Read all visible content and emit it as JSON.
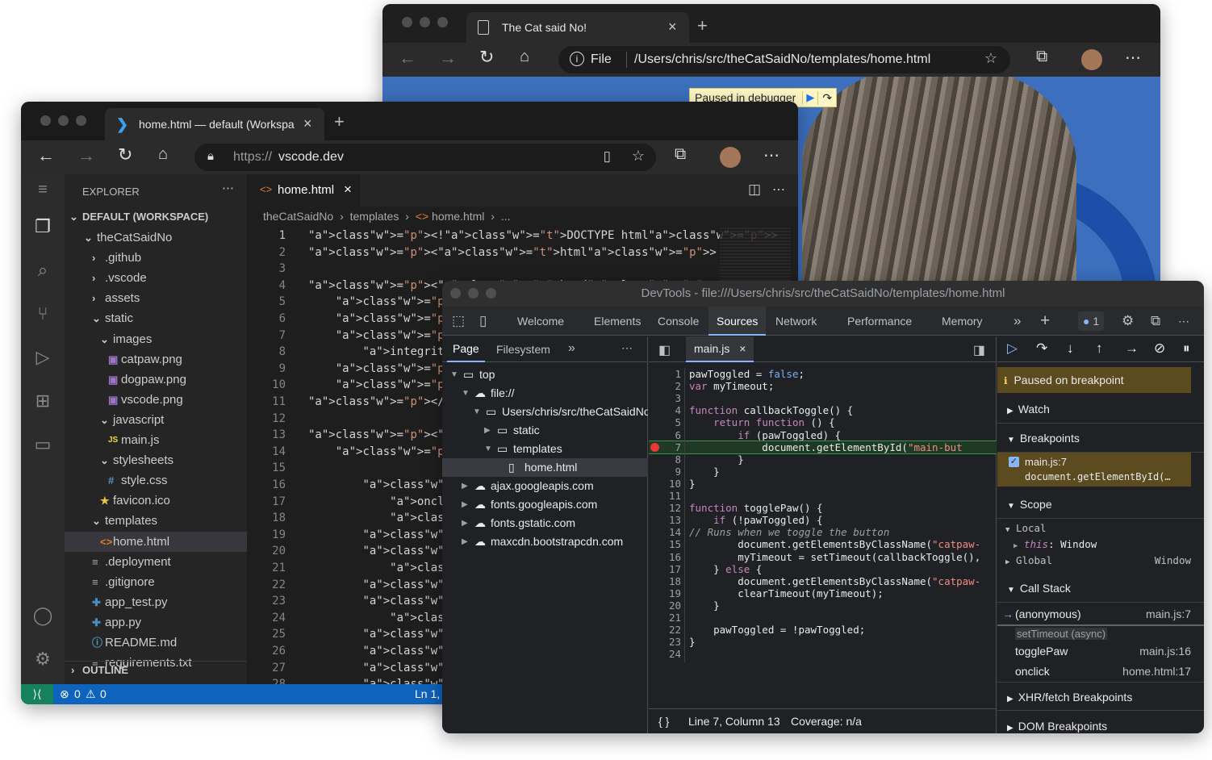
{
  "back_browser": {
    "tab_title": "The Cat said No!",
    "address_scheme": "File",
    "address_path": "/Users/chris/src/theCatSaidNo/templates/home.html",
    "paused_banner": "Paused in debugger"
  },
  "code_browser": {
    "tab_title": "home.html — default (Workspa",
    "address_prefix": "https://",
    "address_host": "vscode.dev"
  },
  "vscode": {
    "explorer_title": "EXPLORER",
    "workspace": "DEFAULT (WORKSPACE)",
    "tree": [
      {
        "label": "theCatSaidNo",
        "depth": 0,
        "kind": "folder-open"
      },
      {
        "label": ".github",
        "depth": 1,
        "kind": "folder"
      },
      {
        "label": ".vscode",
        "depth": 1,
        "kind": "folder"
      },
      {
        "label": "assets",
        "depth": 1,
        "kind": "folder"
      },
      {
        "label": "static",
        "depth": 1,
        "kind": "folder-open"
      },
      {
        "label": "images",
        "depth": 2,
        "kind": "folder-open"
      },
      {
        "label": "catpaw.png",
        "depth": 3,
        "kind": "image"
      },
      {
        "label": "dogpaw.png",
        "depth": 3,
        "kind": "image"
      },
      {
        "label": "vscode.png",
        "depth": 3,
        "kind": "image"
      },
      {
        "label": "javascript",
        "depth": 2,
        "kind": "folder-open"
      },
      {
        "label": "main.js",
        "depth": 3,
        "kind": "js"
      },
      {
        "label": "stylesheets",
        "depth": 2,
        "kind": "folder-open"
      },
      {
        "label": "style.css",
        "depth": 3,
        "kind": "css"
      },
      {
        "label": "favicon.ico",
        "depth": 2,
        "kind": "star"
      },
      {
        "label": "templates",
        "depth": 1,
        "kind": "folder-open"
      },
      {
        "label": "home.html",
        "depth": 2,
        "kind": "html"
      },
      {
        "label": ".deployment",
        "depth": 1,
        "kind": "text"
      },
      {
        "label": ".gitignore",
        "depth": 1,
        "kind": "text"
      },
      {
        "label": "app_test.py",
        "depth": 1,
        "kind": "py"
      },
      {
        "label": "app.py",
        "depth": 1,
        "kind": "py"
      },
      {
        "label": "README.md",
        "depth": 1,
        "kind": "info"
      },
      {
        "label": "requirements.txt",
        "depth": 1,
        "kind": "text"
      }
    ],
    "outline_label": "OUTLINE",
    "editor_tab": "home.html",
    "breadcrumb": [
      "theCatSaidNo",
      "templates",
      "home.html",
      "..."
    ],
    "code_lines": [
      "<!DOCTYPE html>",
      "<html>",
      "",
      "<head>",
      "    <title>The Cat s",
      "    <link href=\"http",
      "    <link rel=\"style",
      "        integrity=\"s",
      "    <link rel=\"style",
      "    <link rel='style",
      "</head>",
      "",
      "<body class=\"preload",
      "    <div class=\"cent",
      "",
      "        <button type",
      "            onclick=",
      "            <div cla",
      "        </button>",
      "        <div class=\"",
      "            <img cla",
      "        </div>",
      "        <div>",
      "            <h1 styl",
      "        </div>",
      "        <script src=",
      "        <script src=",
      "        <script>"
    ],
    "status_errors": "0",
    "status_warnings": "0",
    "status_position": "Ln 1,"
  },
  "devtools": {
    "title": "DevTools - file:///Users/chris/src/theCatSaidNo/templates/home.html",
    "tabs": [
      "Welcome",
      "Elements",
      "Console",
      "Sources",
      "Network",
      "Performance",
      "Memory"
    ],
    "active_tab": "Sources",
    "issues_count": "1",
    "nav_tabs": [
      "Page",
      "Filesystem"
    ],
    "nav_tree": [
      {
        "label": "top",
        "depth": 0,
        "kind": "frame"
      },
      {
        "label": "file://",
        "depth": 1,
        "kind": "cloud"
      },
      {
        "label": "Users/chris/src/theCatSaidNo",
        "depth": 2,
        "kind": "folder"
      },
      {
        "label": "static",
        "depth": 3,
        "kind": "folder"
      },
      {
        "label": "templates",
        "depth": 3,
        "kind": "folder"
      },
      {
        "label": "home.html",
        "depth": 4,
        "kind": "file"
      },
      {
        "label": "ajax.googleapis.com",
        "depth": 1,
        "kind": "cloud"
      },
      {
        "label": "fonts.googleapis.com",
        "depth": 1,
        "kind": "cloud"
      },
      {
        "label": "fonts.gstatic.com",
        "depth": 1,
        "kind": "cloud"
      },
      {
        "label": "maxcdn.bootstrapcdn.com",
        "depth": 1,
        "kind": "cloud"
      }
    ],
    "source_tab": "main.js",
    "source_lines": [
      "pawToggled = false;",
      "var myTimeout;",
      "",
      "function callbackToggle() {",
      "    return function () {",
      "        if (pawToggled) {",
      "            document.getElementById(\"main-but",
      "        }",
      "    }",
      "}",
      "",
      "function togglePaw() {",
      "    if (!pawToggled) {",
      "        // Runs when we toggle the button",
      "        document.getElementsByClassName(\"catpaw-",
      "        myTimeout = setTimeout(callbackToggle(),",
      "    } else {",
      "        document.getElementsByClassName(\"catpaw-",
      "        clearTimeout(myTimeout);",
      "    }",
      "",
      "    pawToggled = !pawToggled;",
      "}",
      ""
    ],
    "breakpoint_line": 7,
    "status_braces": "{ }",
    "status_position": "Line 7, Column 13",
    "status_coverage": "Coverage: n/a",
    "paused_text": "Paused on breakpoint",
    "sections": {
      "watch": "Watch",
      "breakpoints": "Breakpoints",
      "scope": "Scope",
      "call_stack": "Call Stack",
      "xhr": "XHR/fetch Breakpoints",
      "dom": "DOM Breakpoints"
    },
    "breakpoint_item": {
      "file": "main.js:7",
      "code": "document.getElementById(…"
    },
    "scope": {
      "local": "Local",
      "this_key": "this",
      "this_val": "Window",
      "global": "Global",
      "global_val": "Window"
    },
    "call_stack": [
      {
        "fn": "(anonymous)",
        "loc": "main.js:7"
      },
      {
        "fn": "togglePaw",
        "loc": "main.js:16"
      },
      {
        "fn": "onclick",
        "loc": "home.html:17"
      }
    ],
    "async_label": "setTimeout (async)"
  },
  "colors": {
    "vscode_bg": "#1e1e1e",
    "statusbar": "#0e63bc",
    "devtools_bg": "#202124",
    "paused_bg": "#5c4b1f",
    "breakpoint_red": "#e53935"
  }
}
